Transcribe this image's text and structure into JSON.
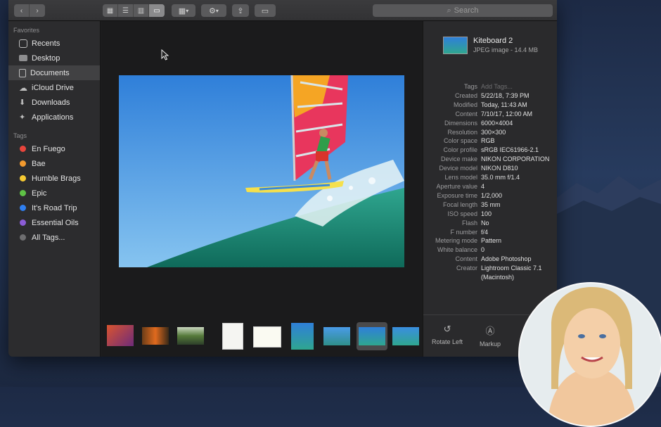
{
  "window": {
    "search_placeholder": "Search"
  },
  "toolbar": {
    "back_icon": "chevron-left-icon",
    "forward_icon": "chevron-right-icon",
    "view_modes": [
      "icon-view",
      "list-view",
      "column-view",
      "gallery-view"
    ],
    "active_view": "gallery-view"
  },
  "sidebar": {
    "favorites_header": "Favorites",
    "favorites": [
      {
        "label": "Recents",
        "icon": "clock-icon"
      },
      {
        "label": "Desktop",
        "icon": "desktop-icon"
      },
      {
        "label": "Documents",
        "icon": "document-icon",
        "active": true
      },
      {
        "label": "iCloud Drive",
        "icon": "cloud-icon"
      },
      {
        "label": "Downloads",
        "icon": "download-icon"
      },
      {
        "label": "Applications",
        "icon": "applications-icon"
      }
    ],
    "tags_header": "Tags",
    "tags": [
      {
        "label": "En Fuego",
        "color": "#e8453c"
      },
      {
        "label": "Bae",
        "color": "#f29a2e"
      },
      {
        "label": "Humble Brags",
        "color": "#f5c932"
      },
      {
        "label": "Epic",
        "color": "#5ec145"
      },
      {
        "label": "It's Road Trip",
        "color": "#2f7ff0"
      },
      {
        "label": "Essential Oils",
        "color": "#8b5cd6"
      },
      {
        "label": "All Tags...",
        "color": "#7a7a7c"
      }
    ]
  },
  "info": {
    "file_name": "Kiteboard 2",
    "file_type": "JPEG image - 14.4 MB",
    "metadata": [
      {
        "key": "Tags",
        "value": "Add Tags...",
        "placeholder": true
      },
      {
        "key": "Created",
        "value": "5/22/18, 7:39 PM"
      },
      {
        "key": "Modified",
        "value": "Today, 11:43 AM"
      },
      {
        "key": "Content",
        "value": "7/10/17, 12:00 AM"
      },
      {
        "key": "Dimensions",
        "value": "6000×4004"
      },
      {
        "key": "Resolution",
        "value": "300×300"
      },
      {
        "key": "Color space",
        "value": "RGB"
      },
      {
        "key": "Color profile",
        "value": "sRGB IEC61966-2.1"
      },
      {
        "key": "Device make",
        "value": "NIKON CORPORATION"
      },
      {
        "key": "Device model",
        "value": "NIKON D810"
      },
      {
        "key": "Lens model",
        "value": "35.0 mm f/1.4"
      },
      {
        "key": "Aperture value",
        "value": "4"
      },
      {
        "key": "Exposure time",
        "value": "1/2,000"
      },
      {
        "key": "Focal length",
        "value": "35 mm"
      },
      {
        "key": "ISO speed",
        "value": "100"
      },
      {
        "key": "Flash",
        "value": "No"
      },
      {
        "key": "F number",
        "value": "f/4"
      },
      {
        "key": "Metering mode",
        "value": "Pattern"
      },
      {
        "key": "White balance",
        "value": "0"
      },
      {
        "key": "Content",
        "value": "Adobe Photoshop"
      },
      {
        "key": "Creator",
        "value": "Lightroom Classic 7.1 (Macintosh)"
      }
    ],
    "actions": [
      {
        "label": "Rotate Left",
        "icon": "rotate-left-icon"
      },
      {
        "label": "Markup",
        "icon": "markup-icon"
      }
    ]
  },
  "colors": {
    "accent": "#3a3a3c",
    "window_bg": "#1e1e1f"
  }
}
